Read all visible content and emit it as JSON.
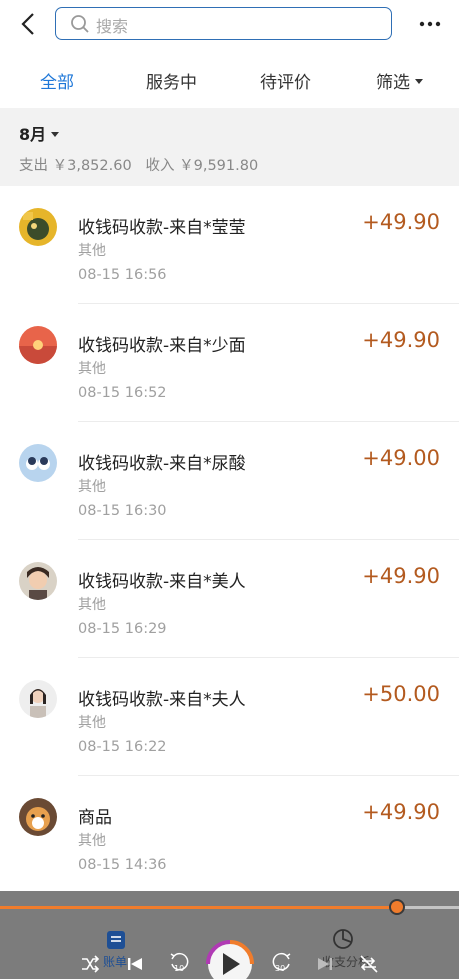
{
  "header": {
    "search_placeholder": "搜索"
  },
  "tabs": [
    {
      "label": "全部",
      "active": true
    },
    {
      "label": "服务中",
      "active": false
    },
    {
      "label": "待评价",
      "active": false
    },
    {
      "label": "筛选",
      "active": false
    }
  ],
  "summary": {
    "month": "8月",
    "text": "支出 ￥3,852.60   收入 ￥9,591.80"
  },
  "transactions": [
    {
      "title": "收钱码收款-来自*莹莹",
      "category": "其他",
      "time": "08-15 16:56",
      "amount": "+49.90"
    },
    {
      "title": "收钱码收款-来自*少面",
      "category": "其他",
      "time": "08-15 16:52",
      "amount": "+49.90"
    },
    {
      "title": "收钱码收款-来自*尿酸",
      "category": "其他",
      "time": "08-15 16:30",
      "amount": "+49.00"
    },
    {
      "title": "收钱码收款-来自*美人",
      "category": "其他",
      "time": "08-15 16:29",
      "amount": "+49.90"
    },
    {
      "title": "收钱码收款-来自*夫人",
      "category": "其他",
      "time": "08-15 16:22",
      "amount": "+50.00"
    },
    {
      "title": "商品",
      "category": "其他",
      "time": "08-15 14:36",
      "amount": "+49.90"
    }
  ],
  "bottom_tabs": {
    "bill_label": "账单",
    "analysis_label": "收支分析"
  },
  "media": {
    "progress": 0.865,
    "rewind_seconds": "10",
    "forward_seconds": "30"
  },
  "colors": {
    "accent": "#1e77d8",
    "amount": "#b35a1f",
    "progress": "#f07c2c"
  }
}
